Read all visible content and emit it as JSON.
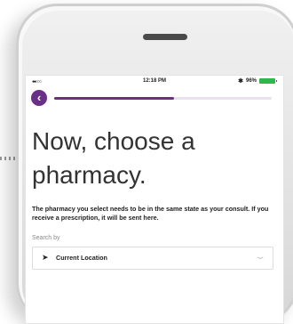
{
  "status_bar": {
    "signal": "●●○○○",
    "time": "12:18 PM",
    "battery_percent": "96%",
    "bluetooth_icon": "bluetooth-icon",
    "battery_icon": "battery-icon"
  },
  "progress": {
    "fraction": 0.55,
    "color": "#6a2f86",
    "back_icon": "chevron-left-icon"
  },
  "headline": "Now, choose a pharmacy.",
  "description": "The pharmacy you select needs to be in the same state as your consult. If you receive a prescription, it will be sent here.",
  "search": {
    "label": "Search by",
    "selected": "Current Location",
    "location_icon": "location-arrow-icon",
    "dropdown_icon": "chevron-down-icon"
  }
}
